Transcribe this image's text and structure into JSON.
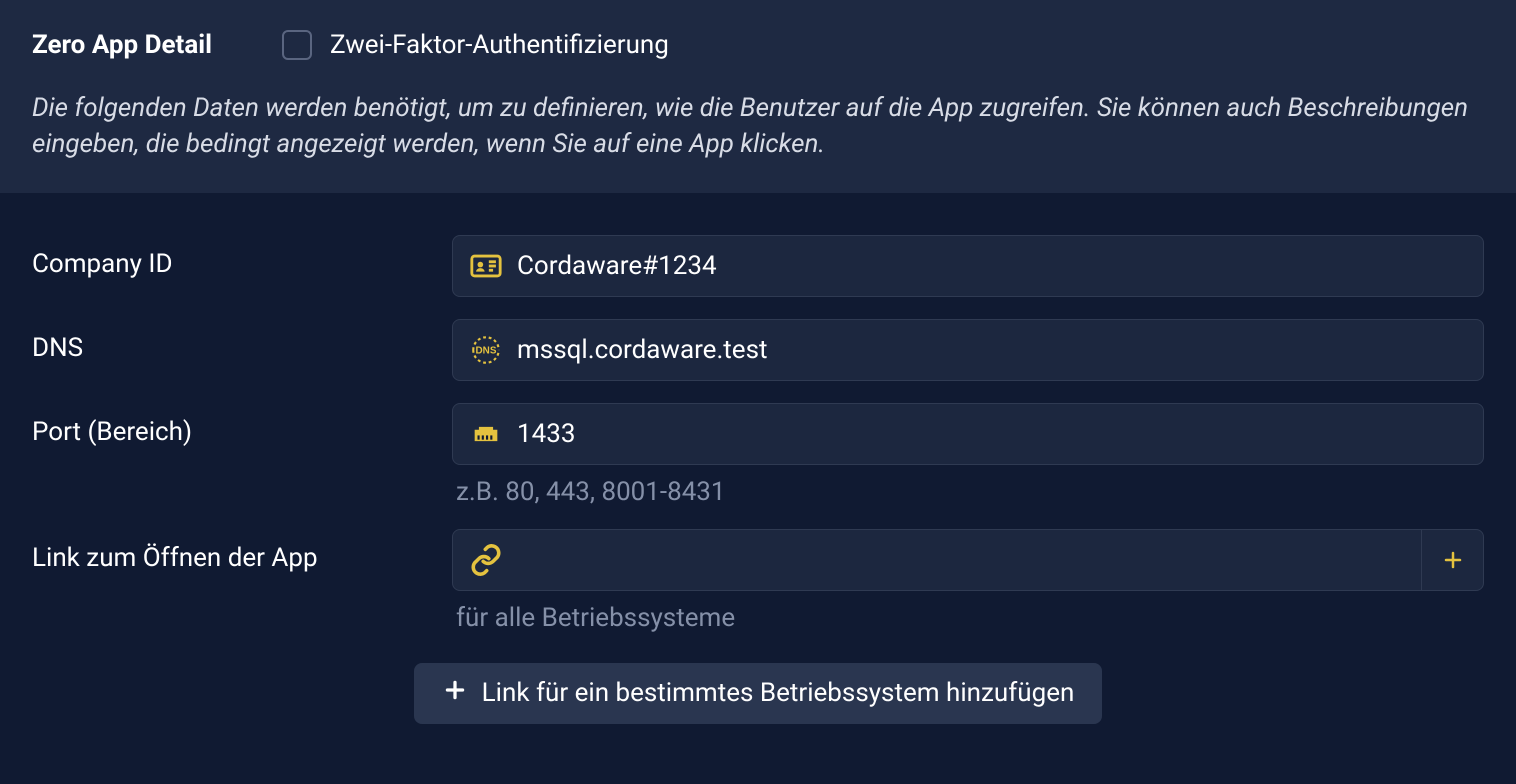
{
  "header": {
    "title": "Zero App Detail",
    "two_factor_label": "Zwei-Faktor-Authentifizierung",
    "two_factor_checked": false,
    "description": "Die folgenden Daten werden benötigt, um zu definieren, wie die Benutzer auf die App zugreifen. Sie können auch Beschreibungen eingeben, die bedingt angezeigt werden, wenn Sie auf eine App klicken."
  },
  "form": {
    "company_id": {
      "label": "Company ID",
      "value": "Cordaware#1234"
    },
    "dns": {
      "label": "DNS",
      "value": "mssql.cordaware.test"
    },
    "port": {
      "label": "Port (Bereich)",
      "value": "1433",
      "hint": "z.B. 80, 443, 8001-8431"
    },
    "open_link": {
      "label": "Link zum Öffnen der App",
      "value": "",
      "hint": "für alle Betriebssysteme"
    }
  },
  "buttons": {
    "add_os_link": "Link für ein bestimmtes Betriebssystem hinzufügen"
  },
  "colors": {
    "accent": "#e4c23f"
  }
}
